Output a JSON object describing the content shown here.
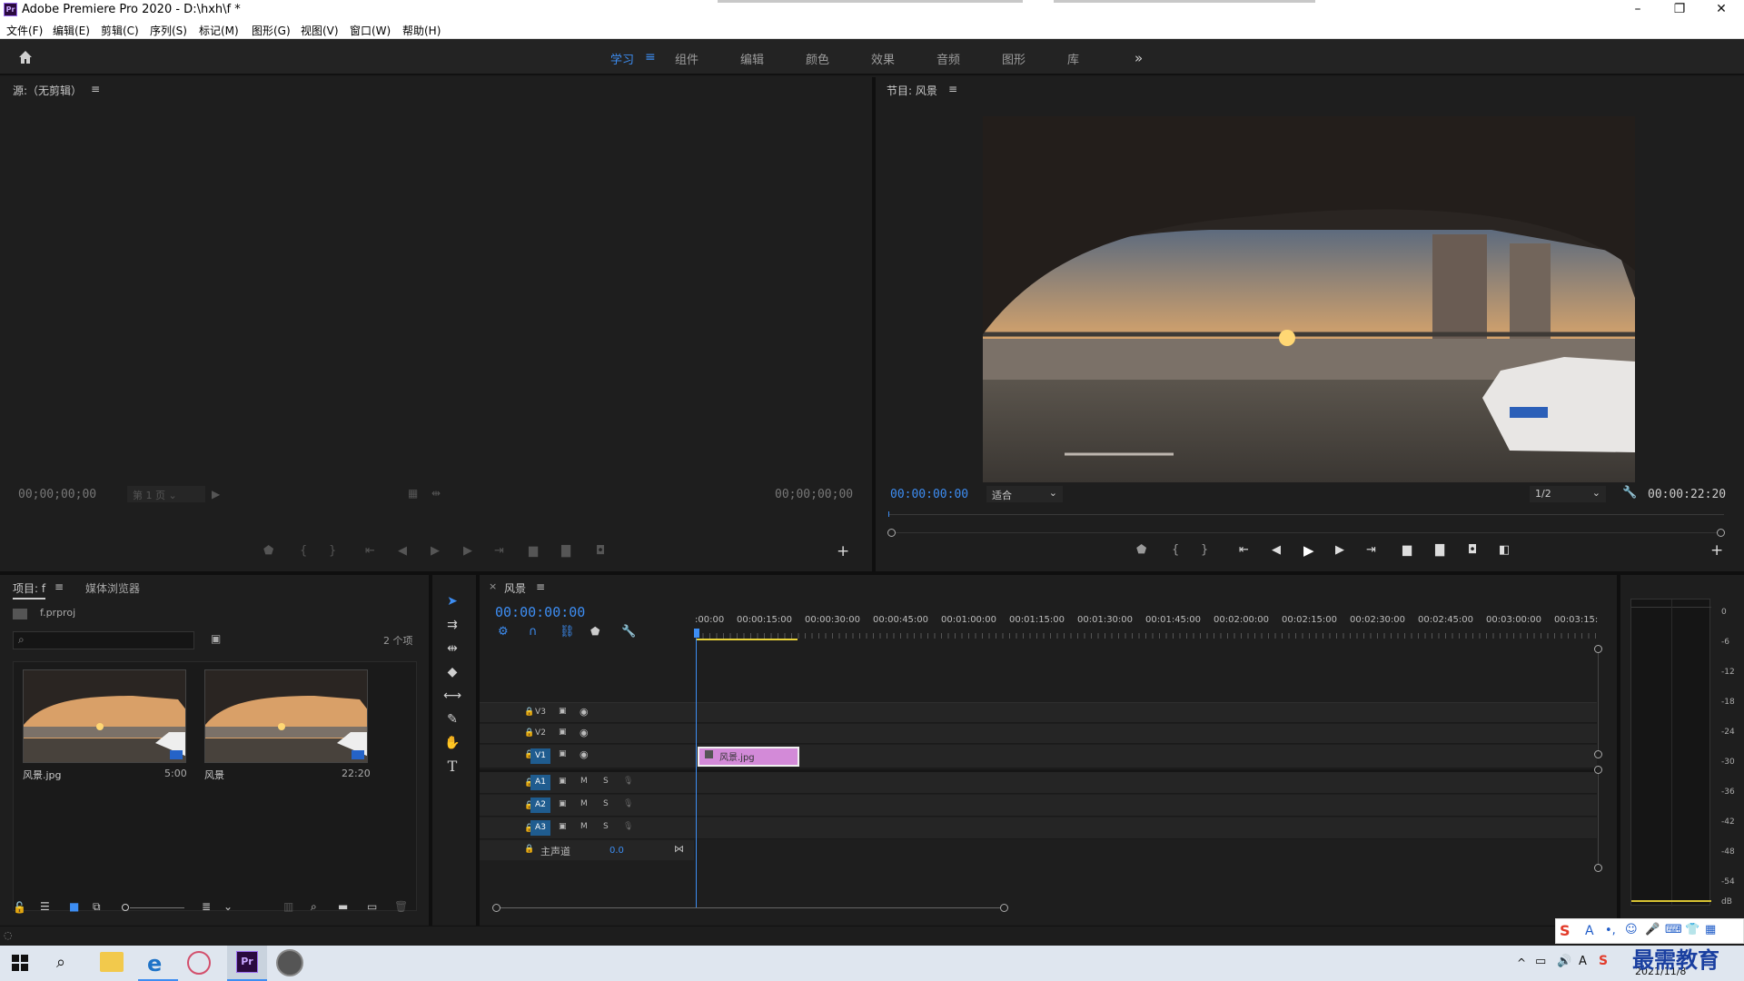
{
  "window": {
    "title": "Adobe Premiere Pro 2020 - D:\\hxh\\f *",
    "logo": "Pr",
    "minimize": "–",
    "restore": "❐",
    "close": "✕"
  },
  "menu": [
    "文件(F)",
    "编辑(E)",
    "剪辑(C)",
    "序列(S)",
    "标记(M)",
    "图形(G)",
    "视图(V)",
    "窗口(W)",
    "帮助(H)"
  ],
  "workspaces": [
    "学习",
    "组件",
    "编辑",
    "颜色",
    "效果",
    "音频",
    "图形",
    "库"
  ],
  "workspace_active": "学习",
  "source": {
    "title": "源:（无剪辑）",
    "tc_left": "00;00;00;00",
    "page_select": "第 1 页",
    "tc_right": "00;00;00;00"
  },
  "program": {
    "title": "节目: 风景",
    "tc_current": "00:00:00:00",
    "fit": "适合",
    "resolution": "1/2",
    "tc_duration": "00:00:22:20"
  },
  "project": {
    "tab": "项目: f",
    "tab2": "媒体浏览器",
    "file": "f.prproj",
    "count": "2 个项",
    "items": [
      {
        "name": "风景.jpg",
        "duration": "5:00"
      },
      {
        "name": "风景",
        "duration": "22:20"
      }
    ]
  },
  "timeline": {
    "tab": "风景",
    "tc": "00:00:00:00",
    "ruler": [
      ":00:00",
      "00:00:15:00",
      "00:00:30:00",
      "00:00:45:00",
      "00:01:00:00",
      "00:01:15:00",
      "00:01:30:00",
      "00:01:45:00",
      "00:02:00:00",
      "00:02:15:00",
      "00:02:30:00",
      "00:02:45:00",
      "00:03:00:00",
      "00:03:15:"
    ],
    "tracks_video": [
      "V3",
      "V2",
      "V1"
    ],
    "tracks_audio": [
      "A1",
      "A2",
      "A3"
    ],
    "mute": "M",
    "solo": "S",
    "master": "主声道",
    "master_val": "0.0",
    "clip": "风景.jpg"
  },
  "meter": {
    "labels": [
      "0",
      "-6",
      "-12",
      "-18",
      "-24",
      "-30",
      "-36",
      "-42",
      "-48",
      "-54",
      "dB"
    ]
  },
  "taskbar": {
    "date": "2021/11/8",
    "watermark": "最需教育"
  }
}
